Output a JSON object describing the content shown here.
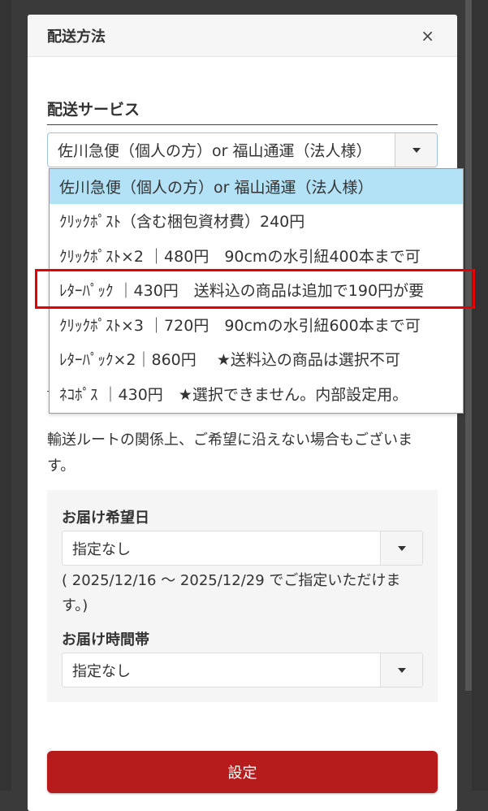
{
  "modal": {
    "title": "配送方法",
    "close_glyph": "×"
  },
  "shipping_service": {
    "heading": "配送サービス",
    "selected_value": "佐川急便（個人の方）or 福山通運（法人様）",
    "options": [
      "佐川急便（個人の方）or 福山通運（法人様）",
      "ｸﾘｯｸﾎﾟｽﾄ（含む梱包資材費）240円",
      "ｸﾘｯｸﾎﾟｽﾄ×2 ｜480円　90cmの水引紐400本まで可",
      "ﾚﾀｰﾊﾟｯｸ ｜430円　送料込の商品は追加で190円が要",
      "ｸﾘｯｸﾎﾟｽﾄ×3 ｜720円　90cmの水引紐600本まで可",
      "ﾚﾀｰﾊﾟｯｸ×2｜860円　 ★送料込の商品は選択不可",
      "ﾈｺﾎﾟｽ ｜430円　★選択できません。内部設定用。"
    ],
    "highlighted_index": 3
  },
  "note": "輸送ルートの関係上、ご希望に沿えない場合もございます。",
  "delivery_date": {
    "label": "お届け希望日",
    "value": "指定なし",
    "range_note": "( 2025/12/16 ～ 2025/12/29 でご指定いただけます。)"
  },
  "delivery_time": {
    "label": "お届け時間帯",
    "value": "指定なし"
  },
  "submit_label": "設定",
  "colors": {
    "submit": "#b71c1c",
    "selected_option": "#b3e1f5",
    "highlight": "#e60000"
  }
}
